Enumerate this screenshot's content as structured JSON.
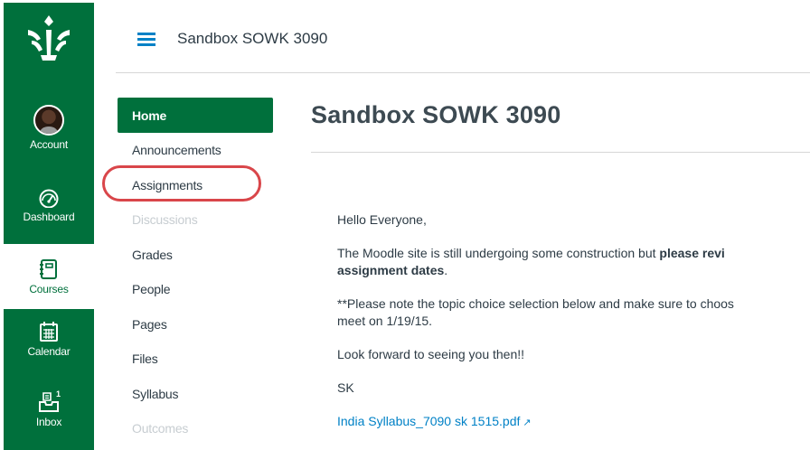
{
  "global_nav": {
    "logo": "university-logo-icon",
    "items": [
      {
        "label": "Account",
        "icon": "avatar"
      },
      {
        "label": "Dashboard",
        "icon": "dashboard-icon"
      },
      {
        "label": "Courses",
        "icon": "courses-icon",
        "active": true
      },
      {
        "label": "Calendar",
        "icon": "calendar-icon"
      },
      {
        "label": "Inbox",
        "icon": "inbox-icon",
        "badge": "1"
      }
    ]
  },
  "header": {
    "breadcrumb": "Sandbox SOWK 3090"
  },
  "course_nav": {
    "items": [
      {
        "label": "Home",
        "state": "active"
      },
      {
        "label": "Announcements",
        "state": "normal"
      },
      {
        "label": "Assignments",
        "state": "normal",
        "highlighted": true
      },
      {
        "label": "Discussions",
        "state": "disabled"
      },
      {
        "label": "Grades",
        "state": "normal"
      },
      {
        "label": "People",
        "state": "normal"
      },
      {
        "label": "Pages",
        "state": "normal"
      },
      {
        "label": "Files",
        "state": "normal"
      },
      {
        "label": "Syllabus",
        "state": "normal"
      },
      {
        "label": "Outcomes",
        "state": "disabled"
      }
    ]
  },
  "content": {
    "title": "Sandbox SOWK 3090",
    "greeting": "Hello Everyone,",
    "para1_start": "The Moodle site is still undergoing some construction but ",
    "para1_bold_1": "please revi",
    "para1_bold_2": "assignment dates",
    "para1_end": ".",
    "para2_line1": "**Please note the topic choice selection below and make sure to choos",
    "para2_line2": "meet on 1/19/15.",
    "para3": "Look forward to seeing you then!!",
    "signature": "SK",
    "file_link": "India Syllabus_7090 sk 1515.pdf"
  },
  "colors": {
    "brand_green": "#00703c",
    "link_blue": "#0081c6",
    "highlight_red": "#d9464a"
  }
}
